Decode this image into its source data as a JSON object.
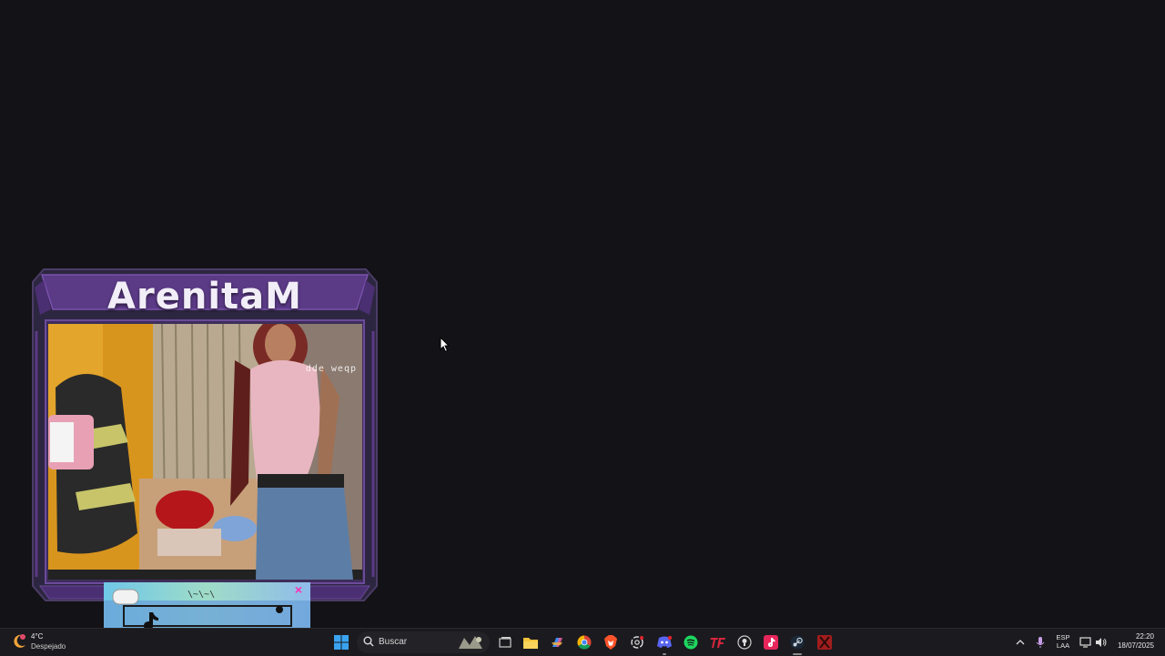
{
  "overlay": {
    "streamer_name": "ArenitaM",
    "cam_watermark": "dde weqp"
  },
  "tiktok_alert": {
    "squiggle": "\\~\\~\\",
    "close_glyph": "×"
  },
  "taskbar": {
    "weather": {
      "temp": "4°C",
      "description": "Despejado"
    },
    "search": {
      "label": "Buscar"
    },
    "apps": [
      "start-menu",
      "task-view",
      "file-explorer",
      "copilot",
      "google-chrome",
      "brave-browser",
      "openai-chatgpt",
      "discord",
      "spotify",
      "tf-app",
      "lightbulb-app",
      "tiktok",
      "steam",
      "dota"
    ],
    "tray": {
      "language_line1": "ESP",
      "language_line2": "LAA",
      "time": "22:20",
      "date": "18/07/2025"
    }
  },
  "colors": {
    "desktop_bg": "#131216",
    "frame_purple": "#5b3a86",
    "frame_dark": "#3a2a52",
    "taskbar_bg": "#1b1b1f",
    "tiktok_close": "#ff2fb3"
  }
}
